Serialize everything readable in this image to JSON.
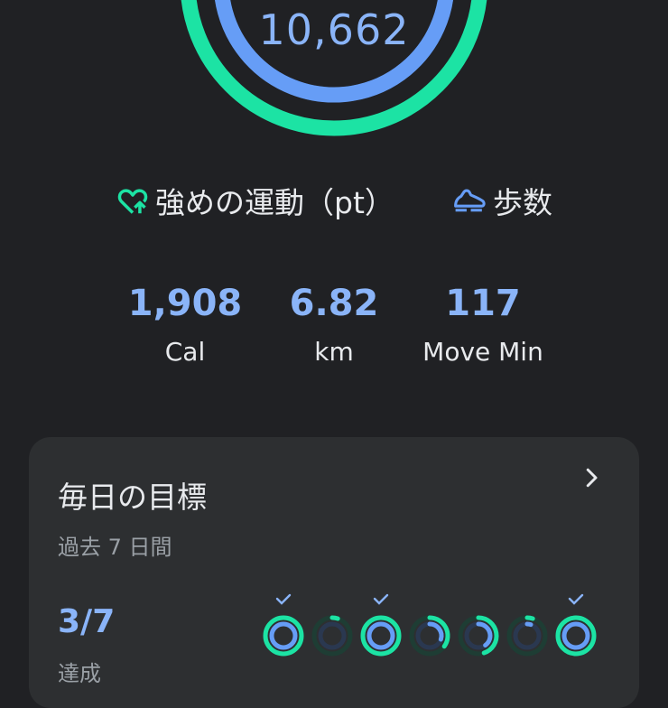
{
  "summary": {
    "steps_value": "10,662",
    "heart_points_fraction": 1.0,
    "steps_fraction": 0.95,
    "colors": {
      "heart_points": "#1ce3a4",
      "steps": "#669df6",
      "background": "#202124"
    }
  },
  "legend": {
    "heart_points_label": "強めの運動（pt）",
    "heart_points_icon": "heart-points-icon",
    "steps_label": "歩数",
    "steps_icon": "steps-shoe-icon"
  },
  "stats": [
    {
      "value": "1,908",
      "label": "Cal"
    },
    {
      "value": "6.82",
      "label": "km"
    },
    {
      "value": "117",
      "label": "Move Min"
    }
  ],
  "daily_goals": {
    "title": "毎日の目標",
    "subtitle": "過去 7 日間",
    "ratio": "3/7",
    "ratio_label": "達成",
    "chevron_icon": "chevron-right-icon",
    "days": [
      {
        "achieved": true,
        "outer": 1.0,
        "inner": 1.0
      },
      {
        "achieved": false,
        "outer": 0.05,
        "inner": 0.0
      },
      {
        "achieved": true,
        "outer": 1.0,
        "inner": 1.0
      },
      {
        "achieved": false,
        "outer": 0.35,
        "inner": 0.3
      },
      {
        "achieved": false,
        "outer": 0.45,
        "inner": 0.4
      },
      {
        "achieved": false,
        "outer": 0.05,
        "inner": 0.05
      },
      {
        "achieved": true,
        "outer": 1.0,
        "inner": 1.0
      }
    ]
  }
}
